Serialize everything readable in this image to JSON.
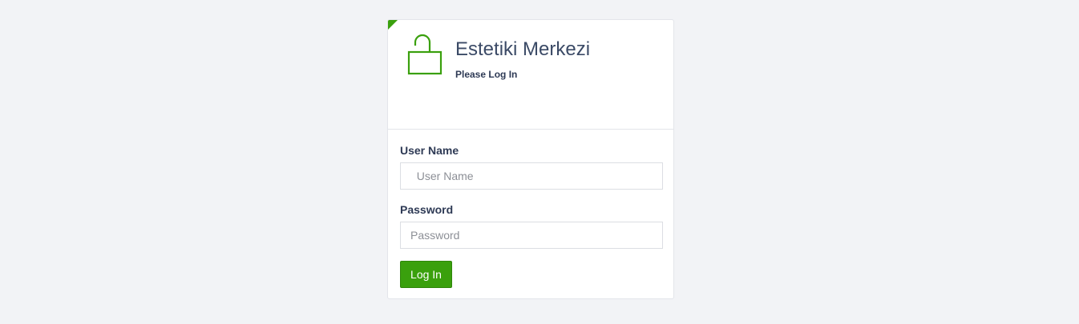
{
  "login": {
    "title": "Estetiki Merkezi",
    "subtitle": "Please Log In",
    "username": {
      "label": "User Name",
      "placeholder": "  User Name",
      "value": ""
    },
    "password": {
      "label": "Password",
      "placeholder": "Password",
      "value": ""
    },
    "submit_label": "Log In",
    "icon": "unlocked-padlock-icon"
  },
  "colors": {
    "accent": "#3aa00d",
    "text": "#3b4a66",
    "background": "#f2f3f6"
  }
}
